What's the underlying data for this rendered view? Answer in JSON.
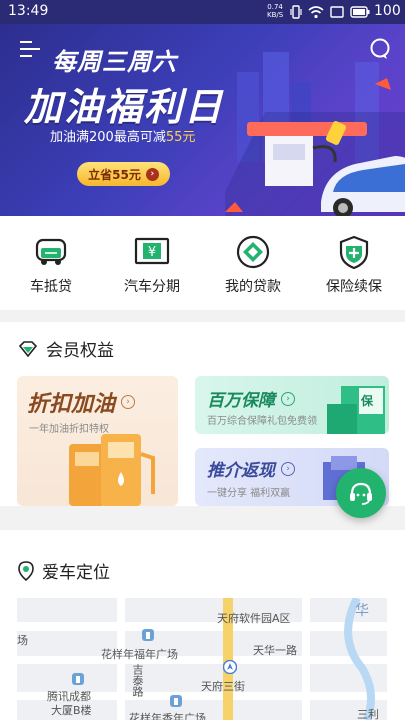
{
  "status_bar": {
    "time": "13:49",
    "net_speed_value": "0.74",
    "net_speed_unit": "KB/S",
    "battery": "100"
  },
  "banner": {
    "line1": "每周三周六",
    "line2": "加油福利日",
    "line3_prefix": "加油满200最高可减",
    "line3_highlight": "55元",
    "save_button": "立省55元"
  },
  "quick_actions": [
    {
      "label": "车抵贷",
      "icon": "car-loan-icon"
    },
    {
      "label": "汽车分期",
      "icon": "yuan-card-icon"
    },
    {
      "label": "我的贷款",
      "icon": "diamond-icon"
    },
    {
      "label": "保险续保",
      "icon": "shield-plus-icon"
    }
  ],
  "member": {
    "title": "会员权益",
    "cards": [
      {
        "title": "折扣加油",
        "sub": "一年加油折扣特权"
      },
      {
        "title": "百万保障",
        "sub": "百万综合保障礼包免费领",
        "badge": "保"
      },
      {
        "title": "推介返现",
        "sub": "一键分享 福利双赢"
      }
    ]
  },
  "car_location": {
    "title": "爱车定位",
    "map_labels": [
      "天府软件园A区",
      "华",
      "场",
      "花样年福年广场",
      "天华一路",
      "吉泰路",
      "天府三街",
      "腾讯成都",
      "大厦B楼",
      "花样年香年广场",
      "三利"
    ]
  },
  "colors": {
    "accent": "#22b36e",
    "banner": "#3c3fb8"
  }
}
